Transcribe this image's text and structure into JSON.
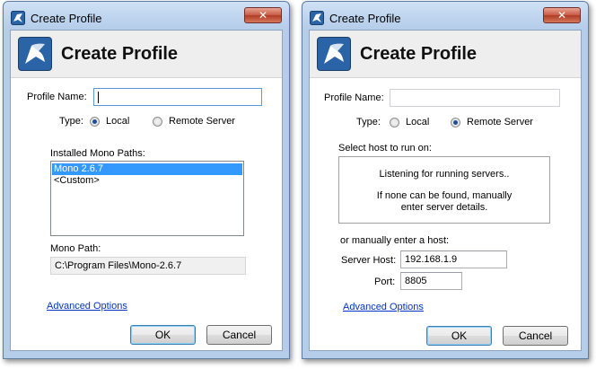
{
  "left_dialog": {
    "window_title": "Create Profile",
    "header_title": "Create Profile",
    "profile_name_label": "Profile Name:",
    "profile_name_value": "",
    "type_label": "Type:",
    "type_local": "Local",
    "type_remote": "Remote Server",
    "selected_type": "Local",
    "installed_paths_label": "Installed Mono Paths:",
    "installed_paths": [
      "Mono 2.6.7",
      "<Custom>"
    ],
    "selected_path": "Mono 2.6.7",
    "mono_path_label": "Mono Path:",
    "mono_path_value": "C:\\Program Files\\Mono-2.6.7",
    "advanced_link": "Advanced Options",
    "ok_label": "OK",
    "cancel_label": "Cancel"
  },
  "right_dialog": {
    "window_title": "Create Profile",
    "header_title": "Create Profile",
    "profile_name_label": "Profile Name:",
    "profile_name_value": "",
    "type_label": "Type:",
    "type_local": "Local",
    "type_remote": "Remote Server",
    "selected_type": "Remote Server",
    "select_host_label": "Select host to run on:",
    "listening_text": "Listening for running servers..",
    "none_found_line1": "If none can be found, manually",
    "none_found_line2": "enter server details.",
    "manual_host_label": "or manually enter a host:",
    "server_host_label": "Server Host:",
    "server_host_value": "192.168.1.9",
    "port_label": "Port:",
    "port_value": "8805",
    "advanced_link": "Advanced Options",
    "ok_label": "OK",
    "cancel_label": "Cancel"
  },
  "icons": {
    "title_icon": "app-icon",
    "logo_icon": "monodevelop-logo-icon",
    "close_icon": "close-icon"
  },
  "colors": {
    "title_bar": "#bcd3ee",
    "selection": "#3399ff",
    "link": "#0033cc",
    "close_button": "#c75a45"
  }
}
